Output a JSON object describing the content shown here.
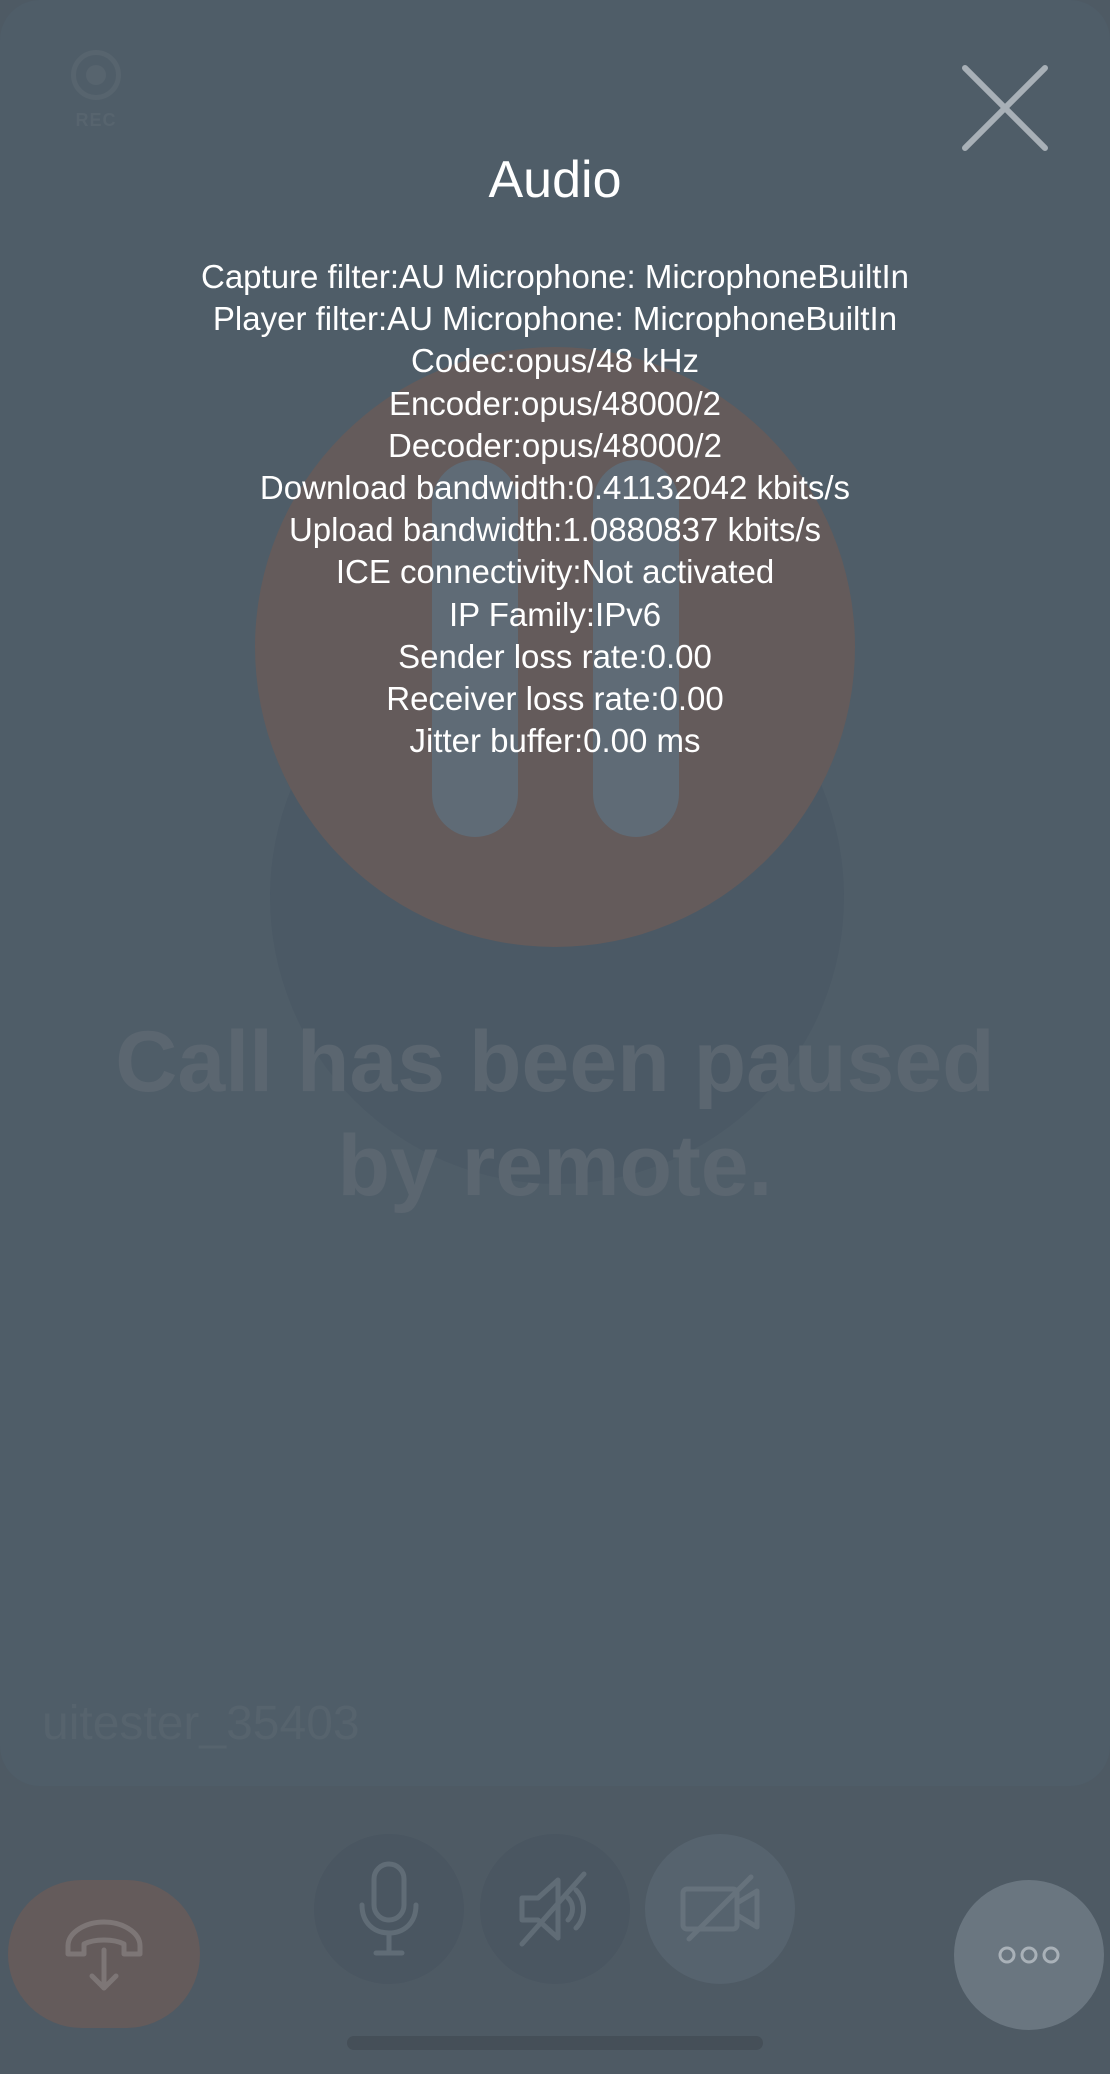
{
  "recording": {
    "label": "REC"
  },
  "call": {
    "status_text_line1": "Call has been paused",
    "status_text_line2": "by remote.",
    "remote_username": "uitester_35403"
  },
  "stats": {
    "title": "Audio",
    "lines": [
      "Capture filter:AU Microphone: MicrophoneBuiltIn",
      "Player filter:AU Microphone: MicrophoneBuiltIn",
      "Codec:opus/48 kHz",
      "Encoder:opus/48000/2",
      "Decoder:opus/48000/2",
      "Download bandwidth:0.41132042 kbits/s",
      "Upload bandwidth:1.0880837 kbits/s",
      "ICE connectivity:Not activated",
      "IP Family:IPv6",
      "Sender loss rate:0.00",
      "Receiver loss rate:0.00",
      "Jitter buffer:0.00 ms"
    ]
  },
  "controls": {
    "hangup_icon": "call-transfer-down-icon",
    "mic_icon": "microphone-icon",
    "speaker_icon": "speaker-muted-icon",
    "video_icon": "video-off-icon",
    "more_icon": "more-dots-icon"
  },
  "colors": {
    "background": "#4f5d68",
    "pause_circle": "#645b5b",
    "hangup": "#645b5b",
    "text": "#ffffff"
  }
}
